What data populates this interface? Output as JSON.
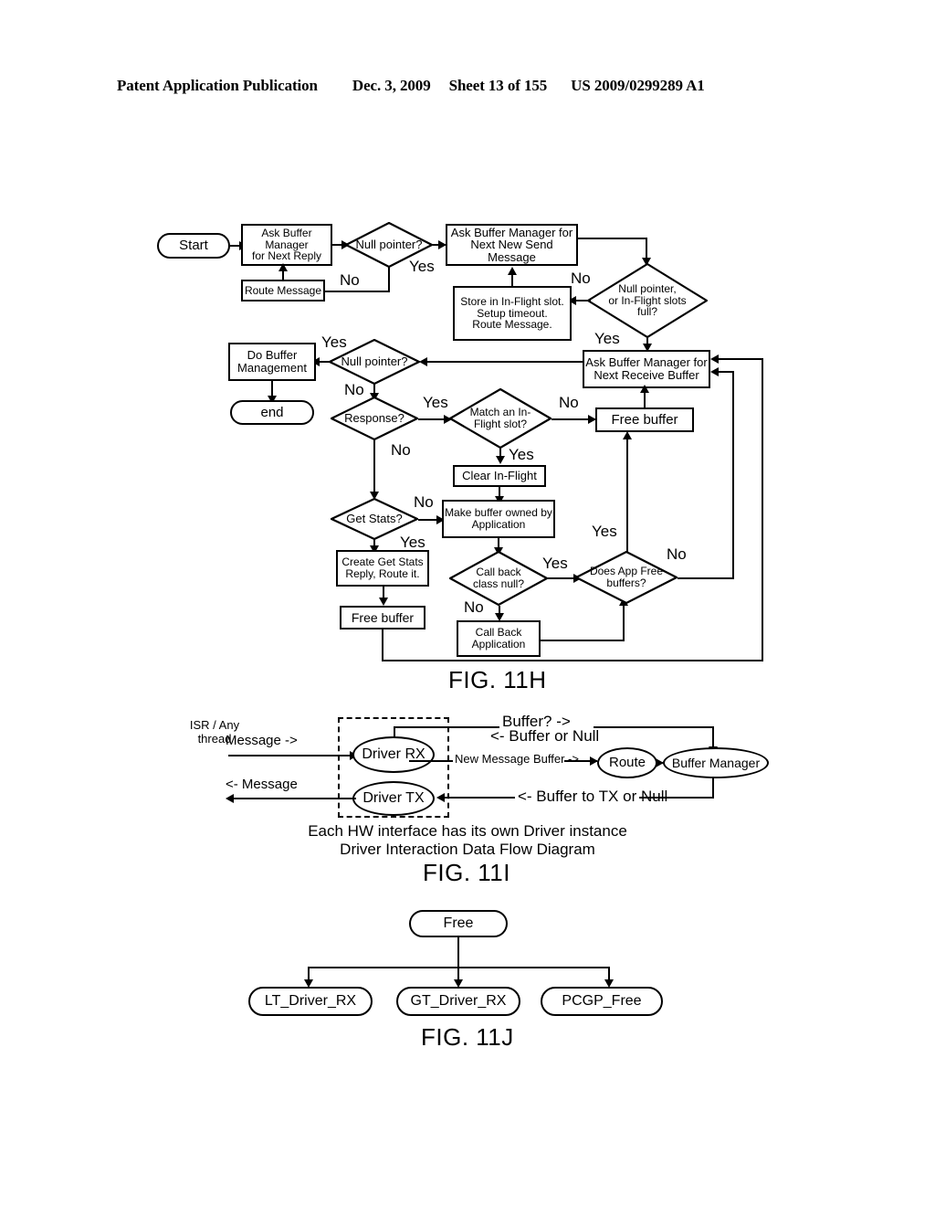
{
  "header": {
    "title": "Patent Application Publication",
    "date": "Dec. 3, 2009",
    "sheet": "Sheet 13 of 155",
    "number": "US 2009/0299289 A1"
  },
  "figures": [
    {
      "id": "fig-11h",
      "caption": "FIG. 11H",
      "nodes": {
        "start": "Start",
        "ask_next_reply": "Ask Buffer Manager\nfor Next Reply",
        "route_message": "Route Message",
        "null_pointer_1": "Null pointer?",
        "ask_next_send": "Ask Buffer Manager for\nNext New Send Message",
        "store_inflight": "Store in In-Flight slot.\nSetup timeout.\nRoute Message.",
        "null_or_full": "Null pointer,\nor In-Flight slots\nfull?",
        "do_buffer_mgmt": "Do Buffer\nManagement",
        "end": "end",
        "null_pointer_2": "Null pointer?",
        "ask_next_receive": "Ask Buffer Manager for\nNext Receive Buffer",
        "response": "Response?",
        "match_inflight": "Match an In-\nFlight slot?",
        "free_buffer_right": "Free buffer",
        "clear_inflight": "Clear In-Flight",
        "get_stats": "Get Stats?",
        "make_buffer_owned": "Make buffer owned by\nApplication",
        "create_get_stats": "Create Get Stats\nReply, Route it.",
        "free_buffer_left": "Free buffer",
        "call_back_class_null": "Call back\nclass null?",
        "does_app_free": "Does App Free\nbuffers?",
        "call_back_application": "Call Back\nApplication"
      },
      "edge_labels": {
        "null1_yes": "Yes",
        "null1_no": "No",
        "nullfull_no": "No",
        "nullfull_yes": "Yes",
        "null2_yes": "Yes",
        "null2_no": "No",
        "response_yes": "Yes",
        "response_no": "No",
        "match_no": "No",
        "match_yes": "Yes",
        "getstats_no": "No",
        "getstats_yes": "Yes",
        "callback_yes": "Yes",
        "callback_no": "No",
        "appfree_yes": "Yes",
        "appfree_no": "No"
      }
    },
    {
      "id": "fig-11i",
      "caption": "FIG. 11I",
      "subcaptions": [
        "Each HW interface has its own Driver instance",
        "Driver Interaction Data Flow Diagram"
      ],
      "nodes": {
        "driver_rx": "Driver RX",
        "driver_tx": "Driver TX",
        "route": "Route",
        "buffer_manager": "Buffer Manager"
      },
      "labels": {
        "isr_any_thread": "ISR / Any\nthread",
        "message_in": "Message ->",
        "message_out": "<- Message",
        "buffer_query": "Buffer? ->",
        "buffer_or_null": "<- Buffer or Null",
        "new_message_buffer": "New Message Buffer ->",
        "buffer_to_tx_or_null": "<- Buffer to TX or Null"
      }
    },
    {
      "id": "fig-11j",
      "caption": "FIG. 11J",
      "nodes": {
        "free": "Free",
        "lt_driver_rx": "LT_Driver_RX",
        "gt_driver_rx": "GT_Driver_RX",
        "pcgp_free": "PCGP_Free"
      }
    }
  ],
  "colors": {
    "ink": "#000000",
    "paper": "#ffffff"
  }
}
